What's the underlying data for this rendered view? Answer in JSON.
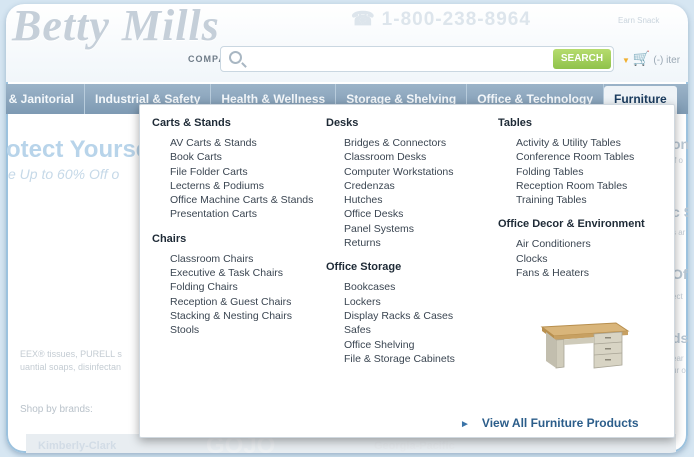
{
  "header": {
    "logo": "Betty Mills",
    "logo_sub": "COMPANY",
    "phone": "1-800-238-8964",
    "earn_text": "Earn Snack",
    "search": {
      "placeholder": "",
      "value": "",
      "button_label": "SEARCH"
    },
    "cart_label": "(-) iter"
  },
  "nav": {
    "items": [
      {
        "label": "g & Janitorial"
      },
      {
        "label": "Industrial & Safety"
      },
      {
        "label": "Health & Wellness"
      },
      {
        "label": "Storage & Shelving"
      },
      {
        "label": "Office & Technology"
      },
      {
        "label": "Furniture"
      }
    ],
    "active": "Furniture"
  },
  "background": {
    "hero_title": "otect Yourse",
    "hero_sub": "e Up to 60% Off o",
    "body_line1": "EEX® tissues, PURELL s",
    "body_line2": "uantial soaps, disinfectan",
    "shop_by_brands": "Shop by brands:",
    "brands": [
      "Kimberly-Clark",
      "GOJO",
      "Georgia-Pacific"
    ],
    "right_col": [
      {
        "title": "on S",
        "sub": "ff o"
      },
      {
        "title": "c S",
        "sub": "s ar"
      },
      {
        "title": "Of",
        "sub": "ect"
      },
      {
        "title": "ds",
        "sub": "ear"
      },
      {
        "title": "",
        "sub": "ur o"
      }
    ]
  },
  "dropdown": {
    "columns": [
      {
        "groups": [
          {
            "title": "Carts & Stands",
            "items": [
              "AV Carts & Stands",
              "Book Carts",
              "File Folder Carts",
              "Lecterns & Podiums",
              "Office Machine Carts & Stands",
              "Presentation Carts"
            ]
          },
          {
            "title": "Chairs",
            "items": [
              "Classroom Chairs",
              "Executive & Task Chairs",
              "Folding Chairs",
              "Reception & Guest Chairs",
              "Stacking & Nesting Chairs",
              "Stools"
            ]
          }
        ]
      },
      {
        "groups": [
          {
            "title": "Desks",
            "items": [
              "Bridges & Connectors",
              "Classroom Desks",
              "Computer Workstations",
              "Credenzas",
              "Hutches",
              "Office Desks",
              "Panel Systems",
              "Returns"
            ]
          },
          {
            "title": "Office Storage",
            "items": [
              "Bookcases",
              "Lockers",
              "Display Racks & Cases",
              "Safes",
              "Office Shelving",
              "File & Storage Cabinets"
            ]
          }
        ]
      },
      {
        "groups": [
          {
            "title": "Tables",
            "items": [
              "Activity & Utility Tables",
              "Conference Room Tables",
              "Folding Tables",
              "Reception Room Tables",
              "Training Tables"
            ]
          },
          {
            "title": "Office Decor & Environment",
            "items": [
              "Air Conditioners",
              "Clocks",
              "Fans & Heaters"
            ]
          }
        ]
      }
    ],
    "view_all": "View All Furniture Products"
  }
}
